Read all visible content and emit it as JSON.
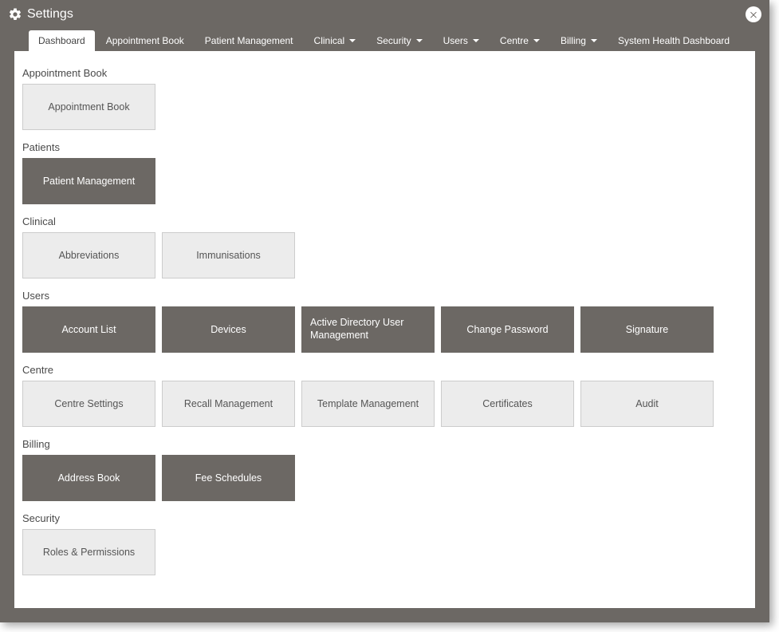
{
  "window": {
    "title": "Settings"
  },
  "tabs": [
    {
      "label": "Dashboard",
      "active": true,
      "caret": false
    },
    {
      "label": "Appointment Book",
      "active": false,
      "caret": false
    },
    {
      "label": "Patient Management",
      "active": false,
      "caret": false
    },
    {
      "label": "Clinical",
      "active": false,
      "caret": true
    },
    {
      "label": "Security",
      "active": false,
      "caret": true
    },
    {
      "label": "Users",
      "active": false,
      "caret": true
    },
    {
      "label": "Centre",
      "active": false,
      "caret": true
    },
    {
      "label": "Billing",
      "active": false,
      "caret": true
    },
    {
      "label": "System Health Dashboard",
      "active": false,
      "caret": false
    }
  ],
  "sections": [
    {
      "heading": "Appointment Book",
      "tiles": [
        {
          "label": "Appointment Book",
          "style": "light",
          "align": "center"
        }
      ]
    },
    {
      "heading": "Patients",
      "tiles": [
        {
          "label": "Patient Management",
          "style": "dark",
          "align": "center"
        }
      ]
    },
    {
      "heading": "Clinical",
      "tiles": [
        {
          "label": "Abbreviations",
          "style": "light",
          "align": "center"
        },
        {
          "label": "Immunisations",
          "style": "light",
          "align": "center"
        }
      ]
    },
    {
      "heading": "Users",
      "tiles": [
        {
          "label": "Account List",
          "style": "dark",
          "align": "center"
        },
        {
          "label": "Devices",
          "style": "dark",
          "align": "center"
        },
        {
          "label": "Active Directory User Management",
          "style": "dark",
          "align": "left"
        },
        {
          "label": "Change Password",
          "style": "dark",
          "align": "center"
        },
        {
          "label": "Signature",
          "style": "dark",
          "align": "center"
        }
      ]
    },
    {
      "heading": "Centre",
      "tiles": [
        {
          "label": "Centre Settings",
          "style": "light",
          "align": "center"
        },
        {
          "label": "Recall Management",
          "style": "light",
          "align": "center"
        },
        {
          "label": "Template Management",
          "style": "light",
          "align": "center"
        },
        {
          "label": "Certificates",
          "style": "light",
          "align": "center"
        },
        {
          "label": "Audit",
          "style": "light",
          "align": "center"
        }
      ]
    },
    {
      "heading": "Billing",
      "tiles": [
        {
          "label": "Address Book",
          "style": "dark",
          "align": "center"
        },
        {
          "label": "Fee Schedules",
          "style": "dark",
          "align": "center"
        }
      ]
    },
    {
      "heading": "Security",
      "tiles": [
        {
          "label": "Roles & Permissions",
          "style": "light",
          "align": "center"
        }
      ]
    }
  ]
}
